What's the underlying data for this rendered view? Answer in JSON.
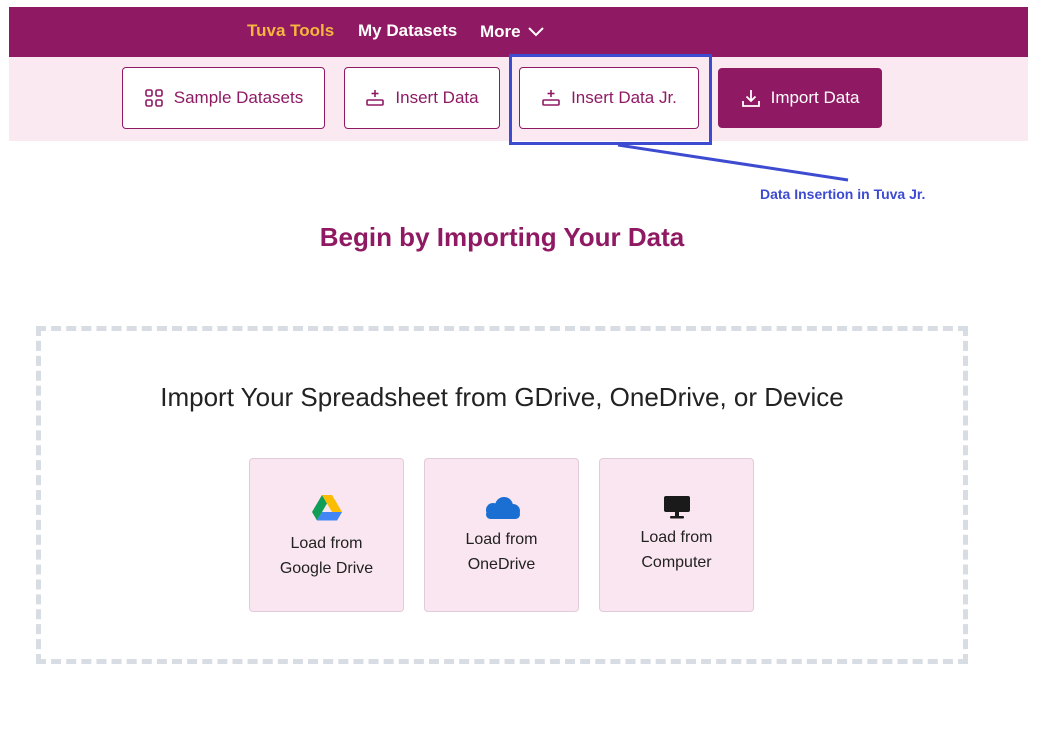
{
  "nav": {
    "items": [
      {
        "label": "Tuva Tools",
        "active": true
      },
      {
        "label": "My Datasets",
        "active": false
      },
      {
        "label": "More",
        "active": false
      }
    ]
  },
  "toolbar": {
    "sample_datasets": "Sample Datasets",
    "insert_data": "Insert Data",
    "insert_data_jr": "Insert Data Jr.",
    "import_data": "Import Data"
  },
  "annotation": {
    "text": "Data Insertion in Tuva Jr.",
    "color": "#3d4bd1"
  },
  "main": {
    "headline": "Begin by Importing Your Data",
    "dropzone_title": "Import Your Spreadsheet from GDrive, OneDrive, or Device",
    "cards": [
      {
        "line1": "Load from",
        "line2": "Google Drive",
        "icon": "google-drive-icon"
      },
      {
        "line1": "Load from",
        "line2": "OneDrive",
        "icon": "onedrive-icon"
      },
      {
        "line1": "Load from",
        "line2": "Computer",
        "icon": "computer-icon"
      }
    ]
  },
  "colors": {
    "brand": "#8f1a63",
    "accent": "#f6b53c",
    "toolbar_bg": "#fae9f1",
    "card_bg": "#fae6f0"
  }
}
